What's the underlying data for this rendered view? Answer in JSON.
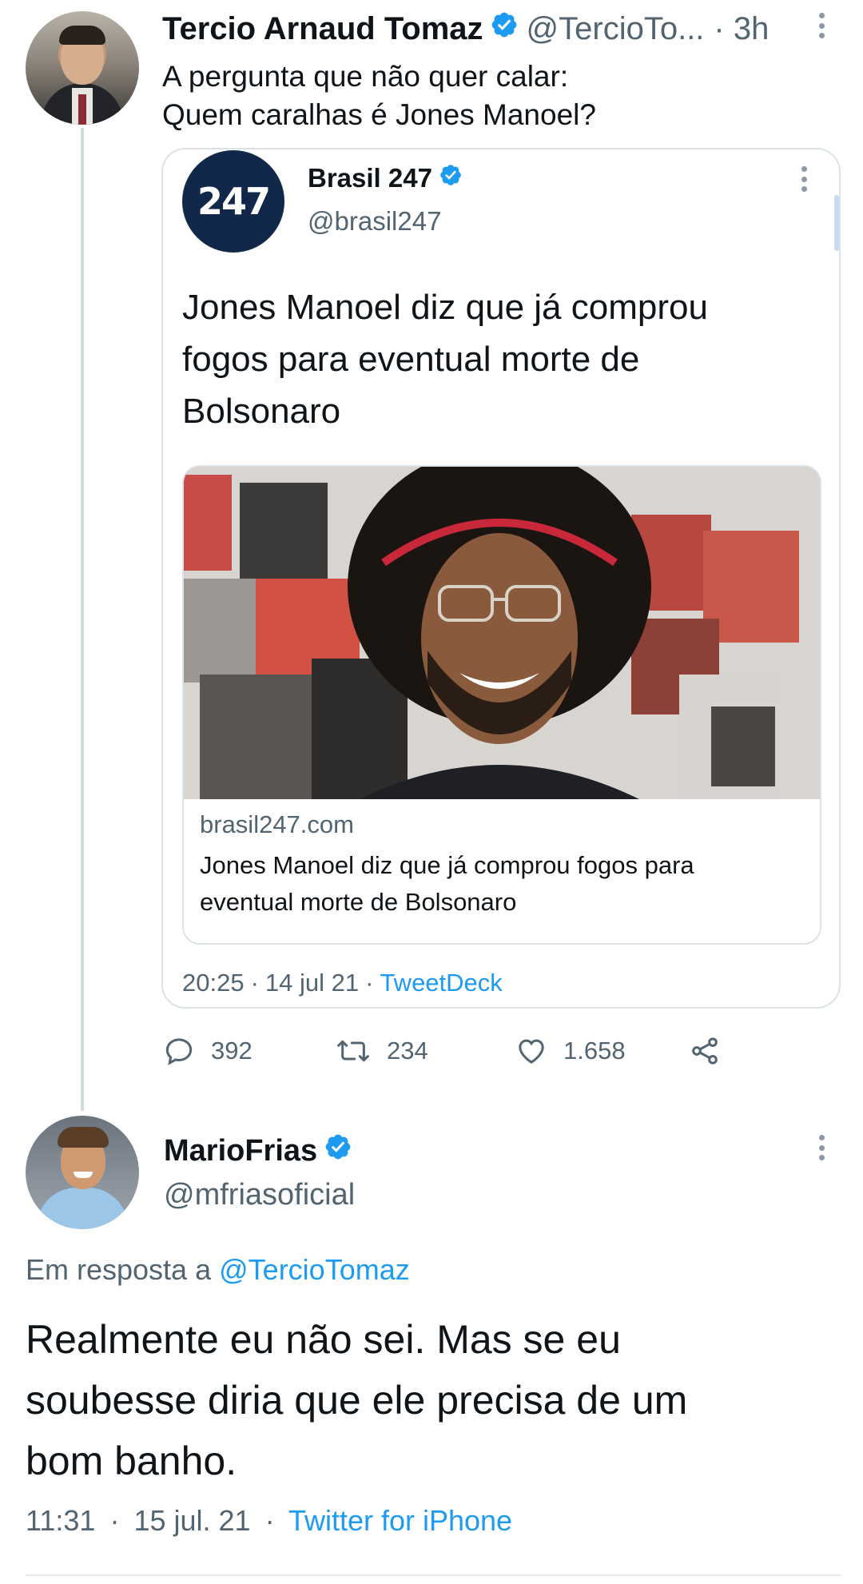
{
  "tweet": {
    "author_name": "Tercio Arnaud Tomaz",
    "handle": "@TercioTo...",
    "time": "· 3h",
    "text_lines": [
      "A pergunta que não quer calar:",
      "Quem caralhas é Jones Manoel?"
    ],
    "stats": {
      "replies": "392",
      "retweets": "234",
      "likes": "1.658"
    }
  },
  "quote": {
    "author_name": "Brasil 247",
    "handle": "@brasil247",
    "avatar_text": "247",
    "headline_lines": [
      "Jones Manoel diz que já comprou",
      "fogos para eventual morte de",
      "Bolsonaro"
    ],
    "link_card": {
      "domain": "brasil247.com",
      "title_lines": [
        "Jones Manoel diz que já comprou fogos para",
        "eventual morte de Bolsonaro"
      ]
    },
    "time": "20:25",
    "date": "14 jul 21",
    "source": "TweetDeck"
  },
  "reply": {
    "author_name": "MarioFrias",
    "handle": "@mfriasoficial",
    "replying_prefix": "Em resposta a",
    "replying_to": "@TercioTomaz",
    "text_lines": [
      "Realmente eu não sei. Mas se eu",
      "soubesse diria que ele precisa de um",
      "bom banho."
    ],
    "time": "11:31",
    "date": "15 jul. 21",
    "source": "Twitter for iPhone"
  },
  "colors": {
    "accent": "#1d9bf0",
    "secondary_text": "#536471",
    "verified": "#1d9bf0"
  },
  "icons": {
    "verified": "verified-badge-icon",
    "more": "more-vertical-icon",
    "reply": "reply-icon",
    "retweet": "retweet-icon",
    "like": "heart-icon",
    "share": "share-icon"
  }
}
